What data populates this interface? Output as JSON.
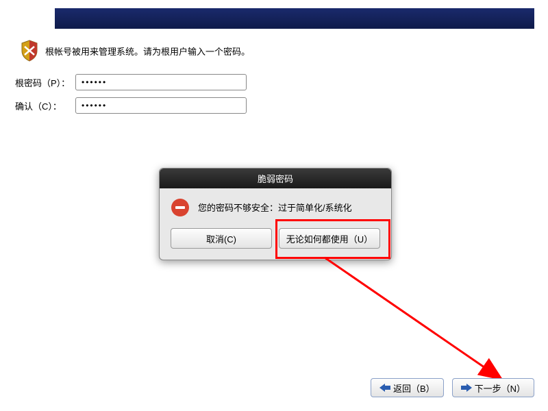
{
  "instruction": "根帐号被用来管理系统。请为根用户输入一个密码。",
  "form": {
    "password_label": "根密码（P）：",
    "password_value": "••••••",
    "confirm_label": "确认（C）：",
    "confirm_value": "••••••"
  },
  "dialog": {
    "title": "脆弱密码",
    "message": "您的密码不够安全：过于简单化/系统化",
    "cancel_label": "取消(C)",
    "use_anyway_label": "无论如何都使用（U）"
  },
  "footer": {
    "back_label": "返回（B）",
    "next_label": "下一步（N）"
  },
  "colors": {
    "header_dark": "#0f1b4a",
    "highlight": "#ff0000"
  }
}
